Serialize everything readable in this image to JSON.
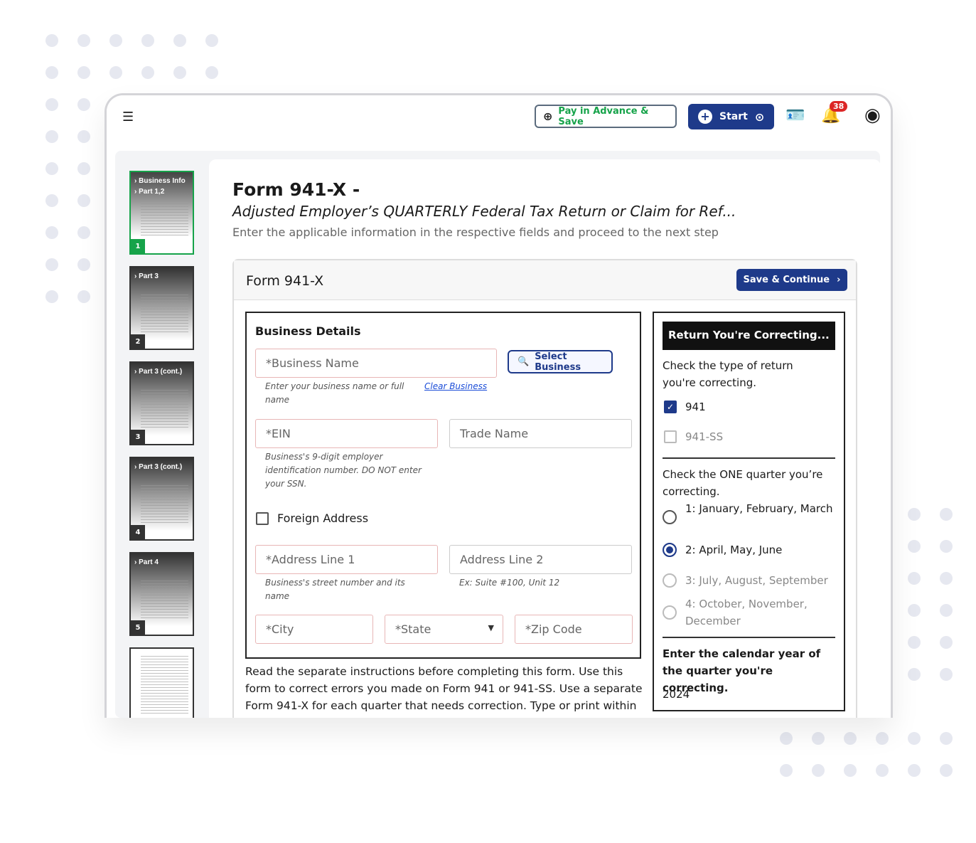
{
  "header": {
    "pay_label": "Pay in Advance & Save",
    "start_label": "Start",
    "notification_count": "38"
  },
  "thumbnails": [
    {
      "label": "Business Info",
      "label2": "Part 1,2",
      "page": "1",
      "active": true
    },
    {
      "label": "Part 3",
      "page": "2"
    },
    {
      "label": "Part 3 (cont.)",
      "page": "3"
    },
    {
      "label": "Part 3 (cont.)",
      "page": "4"
    },
    {
      "label": "Part 4",
      "page": "5"
    }
  ],
  "page": {
    "title": "Form 941-X -",
    "subtitle": "Adjusted Employer’s QUARTERLY Federal Tax Return or Claim for Ref...",
    "hint": "Enter the applicable information in the respective fields and proceed to the next step"
  },
  "panel": {
    "title": "Form 941-X",
    "save_label": "Save & Continue"
  },
  "business": {
    "heading": "Business Details",
    "business_name_ph": "*Business Name",
    "select_business": "Select Business",
    "business_name_help": "Enter your business name or full name",
    "clear_business": "Clear Business",
    "ein_ph": "*EIN",
    "trade_name_ph": "Trade Name",
    "ein_help": "Business's 9-digit employer identification number. DO NOT enter your SSN.",
    "foreign_address": "Foreign Address",
    "address1_ph": "*Address Line 1",
    "address2_ph": "Address Line 2",
    "address1_help": "Business's street number and its name",
    "address2_help": "Ex: Suite #100, Unit 12",
    "city_ph": "*City",
    "state_ph": "*State",
    "zip_ph": "*Zip Code"
  },
  "instructions": "Read the separate instructions before completing this form. Use this form to correct errors you made on Form 941 or 941-SS. Use a separate Form 941-X for each quarter that needs correction. Type or print within the boxes.",
  "return": {
    "heading": "Return You're Correcting...",
    "type_prompt": "Check the type of return you're correcting.",
    "types": [
      {
        "label": "941",
        "checked": true
      },
      {
        "label": "941-SS",
        "checked": false
      }
    ],
    "quarter_prompt": "Check the ONE quarter you’re correcting.",
    "quarters": [
      {
        "label": "1: January, February, March",
        "selected": false
      },
      {
        "label": "2: April, May, June",
        "selected": true
      },
      {
        "label": "3: July, August, September",
        "selected": false
      },
      {
        "label": "4: October, November, December",
        "selected": false
      }
    ],
    "year_prompt": "Enter the calendar year of the quarter you're correcting.",
    "year": "2024"
  },
  "colors": {
    "accent": "#1e3a8a",
    "green": "#16a34a",
    "badge": "#dc2626"
  }
}
